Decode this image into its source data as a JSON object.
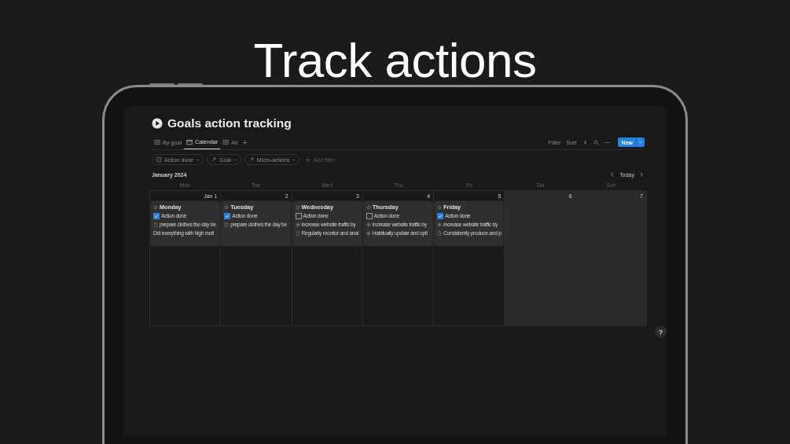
{
  "headline": "Track actions",
  "page": {
    "title": "Goals action tracking"
  },
  "tabs": [
    {
      "label": "By goal",
      "selected": false,
      "kind": "table"
    },
    {
      "label": "Calendar",
      "selected": true,
      "kind": "calendar"
    },
    {
      "label": "All",
      "selected": false,
      "kind": "table"
    }
  ],
  "toolbar": [
    {
      "kind": "text",
      "label": "Filter"
    },
    {
      "kind": "text",
      "label": "Sort"
    },
    {
      "kind": "bolt"
    },
    {
      "kind": "search"
    },
    {
      "kind": "more"
    }
  ],
  "new_button": "New",
  "filters": [
    {
      "label": "Action done",
      "kind": "checkbox"
    },
    {
      "label": "Goal",
      "kind": "relation"
    },
    {
      "label": "Micro-actions",
      "kind": "relation"
    }
  ],
  "add_filter": "Add filter",
  "calendar": {
    "month": "January 2024",
    "today": "Today",
    "weekdays": [
      "Mon",
      "Tue",
      "Wed",
      "Thu",
      "Fri",
      "Sat",
      "Sun"
    ],
    "days": [
      {
        "date": "Jan 1",
        "weekend": false,
        "card": {
          "title": "Monday",
          "props": [
            {
              "kind": "checkbox",
              "label": "Action done",
              "checked": true
            },
            {
              "kind": "page",
              "text": "prepare clothes the day be"
            },
            {
              "kind": "text",
              "text": "Did everything with high moti"
            }
          ]
        }
      },
      {
        "date": "2",
        "weekend": false,
        "card": {
          "title": "Tuesday",
          "props": [
            {
              "kind": "checkbox",
              "label": "Action done",
              "checked": true
            },
            {
              "kind": "page",
              "text": "prepare clothes the day be"
            }
          ]
        }
      },
      {
        "date": "3",
        "weekend": false,
        "card": {
          "title": "Wednesday",
          "props": [
            {
              "kind": "checkbox",
              "label": "Action done",
              "checked": false
            },
            {
              "kind": "goal",
              "text": "increase website traffic by"
            },
            {
              "kind": "page",
              "text": "Regularly monitor and anal"
            }
          ]
        }
      },
      {
        "date": "4",
        "weekend": false,
        "card": {
          "title": "Thursday",
          "props": [
            {
              "kind": "checkbox",
              "label": "Action done",
              "checked": false
            },
            {
              "kind": "goal",
              "text": "increase website traffic by"
            },
            {
              "kind": "goal",
              "text": "Habitually update and opti"
            }
          ]
        }
      },
      {
        "date": "5",
        "weekend": false,
        "card": {
          "title": "Friday",
          "props": [
            {
              "kind": "checkbox",
              "label": "Action done",
              "checked": true
            },
            {
              "kind": "goal",
              "text": "increase website traffic by"
            },
            {
              "kind": "page",
              "text": "Consistently produce and p"
            }
          ]
        }
      },
      {
        "date": "6",
        "weekend": true
      },
      {
        "date": "7",
        "weekend": true
      }
    ]
  },
  "help": "?"
}
